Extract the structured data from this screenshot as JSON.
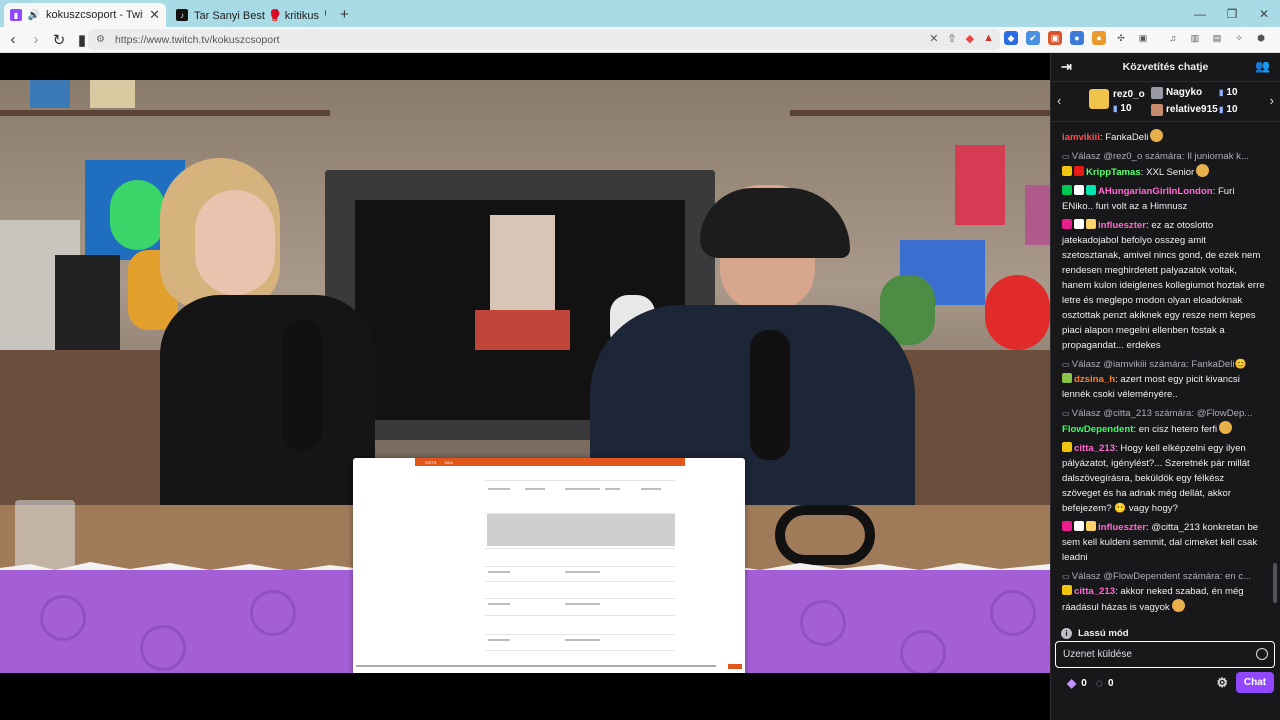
{
  "browser": {
    "tabs": [
      {
        "title": "kokuszcsoport - Twitch",
        "active": true
      },
      {
        "title": "Tar Sanyi Best 🥊 kritikus 🥊 (@szop",
        "active": false
      }
    ],
    "new_tab": "+",
    "url": "https://www.twitch.tv/kokuszcsoport",
    "window_controls": [
      "—",
      "❐",
      "✕"
    ]
  },
  "chat": {
    "header_title": "Közvetítés chatje",
    "gift_leaderboard": [
      {
        "user": "rez0_o",
        "count": "10"
      },
      {
        "user": "Nagyko",
        "count": "10"
      },
      {
        "user": "relative915",
        "count": "10"
      }
    ],
    "messages": [
      {
        "user": "iamvikiii",
        "user_color": "#ff4d4d",
        "text": "FankaDeli",
        "emote": true
      },
      {
        "reply_to": "Válasz @rez0_o számára: Il juniornak k...",
        "user": "KrippTamas",
        "user_color": "#5cff6c",
        "text": "XXL Senior",
        "badges": [
          "#f1c40f",
          "#e91916"
        ],
        "emote": true
      },
      {
        "user": "AHungarianGirlInLondon",
        "user_color": "#ff69d0",
        "text": "Furi ENiko.. furi volt az a Himnusz",
        "badges": [
          "#00c853",
          "#ffffff",
          "#00e5b0"
        ]
      },
      {
        "user": "influeszter",
        "user_color": "#ff69d0",
        "text": "ez az otoslotto jatekadojabol befolyo osszeg amit szetosztanak, amivel nincs gond, de ezek nem rendesen meghirdetett palyazatok voltak, hanem kulon ideiglenes kollegiumot hoztak erre letre és meglepo modon olyan eloadoknak osztottak penzt akiknek egy resze nem kepes piaci alapon megelni ellenben fostak a propagandat... erdekes",
        "badges": [
          "#e91e8c",
          "#ffffff",
          "#ffd26a"
        ]
      },
      {
        "reply_to": "Válasz @iamvikiii számára: FankaDeli😊",
        "user": "dzsina_h",
        "user_color": "#ff7f27",
        "text": "azert most egy picit kivancsi lennék csoki véleményére..",
        "badges": [
          "#8bc34a"
        ]
      },
      {
        "reply_to": "Válasz @citta_213 számára: @FlowDep...",
        "user": "FlowDependent",
        "user_color": "#39ff5e",
        "text": "en cisz hetero ferfi",
        "emote": true
      },
      {
        "user": "citta_213",
        "user_color": "#ff69d0",
        "text": "Hogy kell elképzelni egy ilyen pályázatot, igénylést?... Szeretnék pár millát dalszövegírásra, beküldök egy félkész szöveget és ha adnak még dellát, akkor befejezem? 😶 vagy hogy?",
        "badges": [
          "#f1c40f"
        ]
      },
      {
        "user": "influeszter",
        "user_color": "#ff69d0",
        "text": "@citta_213 konkretan be sem kell kuldeni semmit, dal cimeket kell csak leadni",
        "badges": [
          "#e91e8c",
          "#ffffff",
          "#ffd26a"
        ]
      },
      {
        "reply_to": "Válasz @FlowDependent számára: en c...",
        "user": "citta_213",
        "user_color": "#ff69d0",
        "text": "akkor neked szabad, én még ráadásul házas is vagyok",
        "badges": [
          "#f1c40f"
        ],
        "emote": true
      }
    ],
    "slow_mode": "Lassú mód",
    "input_placeholder": "Üzenet küldése",
    "points_a": "0",
    "points_b": "0",
    "send_label": "Chat"
  },
  "video": {
    "document_header_labels": [
      "WSTK",
      "NKA"
    ]
  },
  "colors": {
    "twitch_purple": "#9147ff",
    "chat_bg": "#18181b",
    "overlay_purple": "#a55fd6",
    "tab_strip": "#a9dbe6"
  }
}
